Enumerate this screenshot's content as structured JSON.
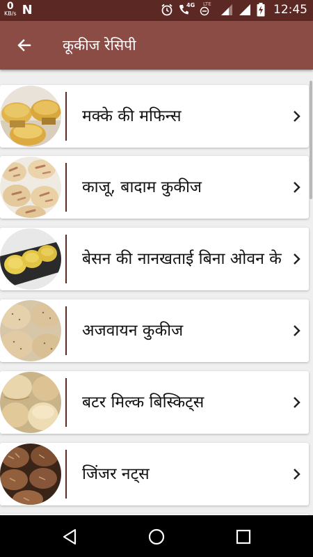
{
  "status_bar": {
    "data_speed_value": "0",
    "data_speed_unit": "KB/s",
    "app_icon_letter": "N",
    "network_label": "4G",
    "lte_label": "LTE",
    "time": "12:45"
  },
  "app_bar": {
    "title": "कूकीज रेसिपी",
    "back_icon": "arrow-left-icon"
  },
  "recipes": [
    {
      "label": "मक्के की मफिन्स",
      "thumb": "muffins"
    },
    {
      "label": "काजू, बादाम कुकीज",
      "thumb": "almond-cookies"
    },
    {
      "label": "बेसन की नानखताई बिना ओवन के",
      "thumb": "nankhatai"
    },
    {
      "label": "अजवायन कुकीज",
      "thumb": "ajwain-cookies"
    },
    {
      "label": "बटर मिल्क बिस्किट्स",
      "thumb": "buttermilk-biscuits"
    },
    {
      "label": "जिंजर नट्स",
      "thumb": "ginger-nuts"
    }
  ],
  "colors": {
    "status_bar": "#5b2824",
    "app_bar": "#8b4c46",
    "divider": "#5b2824"
  }
}
